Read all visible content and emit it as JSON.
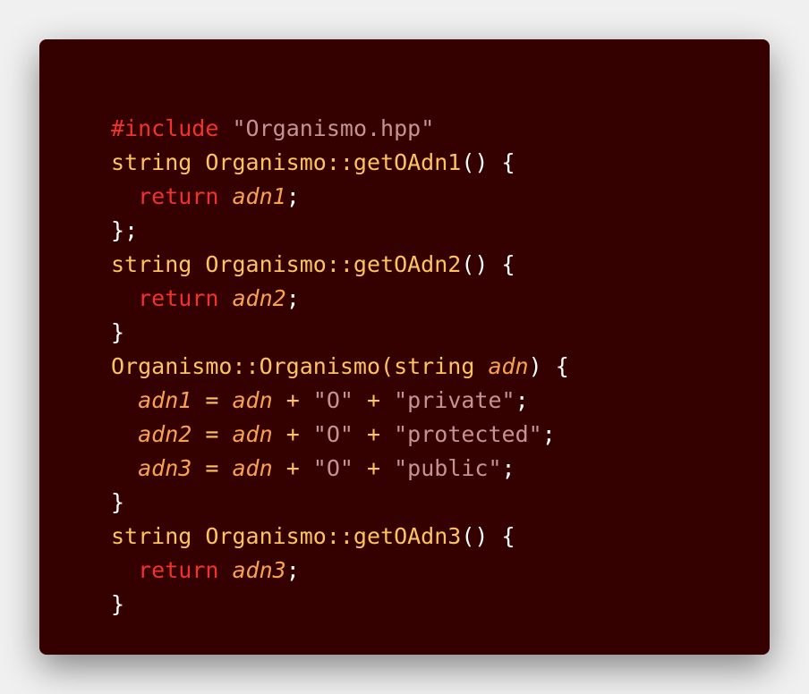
{
  "code": {
    "colors": {
      "keyword": "#f0332b",
      "string": "#c99191",
      "identifier": "#fdc35f",
      "variable": "#f9a24e",
      "punctuation": "#ffffff",
      "background": "#350000"
    },
    "lines": [
      [
        [
          "kw",
          "#include"
        ],
        [
          "p",
          " "
        ],
        [
          "str",
          "\"Organismo.hpp\""
        ]
      ],
      [
        [
          "id",
          "string Organismo::getOAdn1"
        ],
        [
          "p",
          "() {"
        ]
      ],
      [
        [
          "p",
          "  "
        ],
        [
          "kw",
          "return"
        ],
        [
          "p",
          " "
        ],
        [
          "var",
          "adn1"
        ],
        [
          "p",
          ";"
        ]
      ],
      [
        [
          "p",
          "};"
        ]
      ],
      [
        [
          "id",
          "string Organismo::getOAdn2"
        ],
        [
          "p",
          "() {"
        ]
      ],
      [
        [
          "p",
          "  "
        ],
        [
          "kw",
          "return"
        ],
        [
          "p",
          " "
        ],
        [
          "var",
          "adn2"
        ],
        [
          "p",
          ";"
        ]
      ],
      [
        [
          "p",
          "}"
        ]
      ],
      [
        [
          "id",
          "Organismo::Organismo(string"
        ],
        [
          "p",
          " "
        ],
        [
          "var",
          "adn"
        ],
        [
          "p",
          ") {"
        ]
      ],
      [
        [
          "p",
          "  "
        ],
        [
          "var",
          "adn1"
        ],
        [
          "op",
          " = "
        ],
        [
          "var",
          "adn"
        ],
        [
          "op",
          " + "
        ],
        [
          "str",
          "\"O\""
        ],
        [
          "op",
          " + "
        ],
        [
          "str",
          "\"private\""
        ],
        [
          "p",
          ";"
        ]
      ],
      [
        [
          "p",
          "  "
        ],
        [
          "var",
          "adn2"
        ],
        [
          "op",
          " = "
        ],
        [
          "var",
          "adn"
        ],
        [
          "op",
          " + "
        ],
        [
          "str",
          "\"O\""
        ],
        [
          "op",
          " + "
        ],
        [
          "str",
          "\"protected\""
        ],
        [
          "p",
          ";"
        ]
      ],
      [
        [
          "p",
          "  "
        ],
        [
          "var",
          "adn3"
        ],
        [
          "op",
          " = "
        ],
        [
          "var",
          "adn"
        ],
        [
          "op",
          " + "
        ],
        [
          "str",
          "\"O\""
        ],
        [
          "op",
          " + "
        ],
        [
          "str",
          "\"public\""
        ],
        [
          "p",
          ";"
        ]
      ],
      [
        [
          "p",
          "}"
        ]
      ],
      [
        [
          "id",
          "string Organismo::getOAdn3"
        ],
        [
          "p",
          "() {"
        ]
      ],
      [
        [
          "p",
          "  "
        ],
        [
          "kw",
          "return"
        ],
        [
          "p",
          " "
        ],
        [
          "var",
          "adn3"
        ],
        [
          "p",
          ";"
        ]
      ],
      [
        [
          "p",
          "}"
        ]
      ]
    ]
  }
}
